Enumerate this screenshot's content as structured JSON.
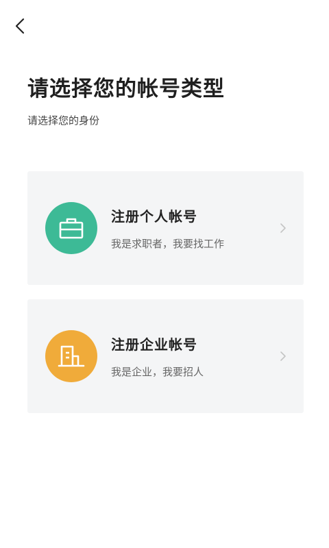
{
  "header": {
    "back_icon": "chevron-left-icon"
  },
  "page": {
    "title": "请选择您的帐号类型",
    "subtitle": "请选择您的身份"
  },
  "cards": [
    {
      "title": "注册个人帐号",
      "description": "我是求职者，我要找工作",
      "icon": "briefcase-icon",
      "icon_bg": "#3dba96"
    },
    {
      "title": "注册企业帐号",
      "description": "我是企业，我要招人",
      "icon": "building-icon",
      "icon_bg": "#f0ab3a"
    }
  ],
  "colors": {
    "card_bg": "#f4f5f6",
    "title_text": "#1f1f1f",
    "secondary_text": "#666666",
    "chevron": "#c4c4c4"
  }
}
